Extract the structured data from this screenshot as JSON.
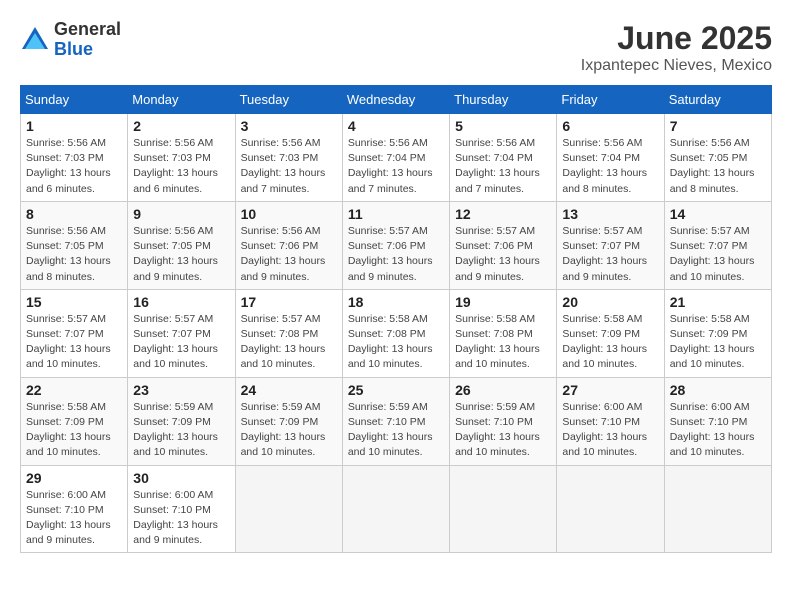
{
  "logo": {
    "general": "General",
    "blue": "Blue"
  },
  "title": {
    "month": "June 2025",
    "location": "Ixpantepec Nieves, Mexico"
  },
  "headers": [
    "Sunday",
    "Monday",
    "Tuesday",
    "Wednesday",
    "Thursday",
    "Friday",
    "Saturday"
  ],
  "weeks": [
    [
      {
        "day": "1",
        "rise": "5:56 AM",
        "set": "7:03 PM",
        "daylight": "13 hours and 6 minutes."
      },
      {
        "day": "2",
        "rise": "5:56 AM",
        "set": "7:03 PM",
        "daylight": "13 hours and 6 minutes."
      },
      {
        "day": "3",
        "rise": "5:56 AM",
        "set": "7:03 PM",
        "daylight": "13 hours and 7 minutes."
      },
      {
        "day": "4",
        "rise": "5:56 AM",
        "set": "7:04 PM",
        "daylight": "13 hours and 7 minutes."
      },
      {
        "day": "5",
        "rise": "5:56 AM",
        "set": "7:04 PM",
        "daylight": "13 hours and 7 minutes."
      },
      {
        "day": "6",
        "rise": "5:56 AM",
        "set": "7:04 PM",
        "daylight": "13 hours and 8 minutes."
      },
      {
        "day": "7",
        "rise": "5:56 AM",
        "set": "7:05 PM",
        "daylight": "13 hours and 8 minutes."
      }
    ],
    [
      {
        "day": "8",
        "rise": "5:56 AM",
        "set": "7:05 PM",
        "daylight": "13 hours and 8 minutes."
      },
      {
        "day": "9",
        "rise": "5:56 AM",
        "set": "7:05 PM",
        "daylight": "13 hours and 9 minutes."
      },
      {
        "day": "10",
        "rise": "5:56 AM",
        "set": "7:06 PM",
        "daylight": "13 hours and 9 minutes."
      },
      {
        "day": "11",
        "rise": "5:57 AM",
        "set": "7:06 PM",
        "daylight": "13 hours and 9 minutes."
      },
      {
        "day": "12",
        "rise": "5:57 AM",
        "set": "7:06 PM",
        "daylight": "13 hours and 9 minutes."
      },
      {
        "day": "13",
        "rise": "5:57 AM",
        "set": "7:07 PM",
        "daylight": "13 hours and 9 minutes."
      },
      {
        "day": "14",
        "rise": "5:57 AM",
        "set": "7:07 PM",
        "daylight": "13 hours and 10 minutes."
      }
    ],
    [
      {
        "day": "15",
        "rise": "5:57 AM",
        "set": "7:07 PM",
        "daylight": "13 hours and 10 minutes."
      },
      {
        "day": "16",
        "rise": "5:57 AM",
        "set": "7:07 PM",
        "daylight": "13 hours and 10 minutes."
      },
      {
        "day": "17",
        "rise": "5:57 AM",
        "set": "7:08 PM",
        "daylight": "13 hours and 10 minutes."
      },
      {
        "day": "18",
        "rise": "5:58 AM",
        "set": "7:08 PM",
        "daylight": "13 hours and 10 minutes."
      },
      {
        "day": "19",
        "rise": "5:58 AM",
        "set": "7:08 PM",
        "daylight": "13 hours and 10 minutes."
      },
      {
        "day": "20",
        "rise": "5:58 AM",
        "set": "7:09 PM",
        "daylight": "13 hours and 10 minutes."
      },
      {
        "day": "21",
        "rise": "5:58 AM",
        "set": "7:09 PM",
        "daylight": "13 hours and 10 minutes."
      }
    ],
    [
      {
        "day": "22",
        "rise": "5:58 AM",
        "set": "7:09 PM",
        "daylight": "13 hours and 10 minutes."
      },
      {
        "day": "23",
        "rise": "5:59 AM",
        "set": "7:09 PM",
        "daylight": "13 hours and 10 minutes."
      },
      {
        "day": "24",
        "rise": "5:59 AM",
        "set": "7:09 PM",
        "daylight": "13 hours and 10 minutes."
      },
      {
        "day": "25",
        "rise": "5:59 AM",
        "set": "7:10 PM",
        "daylight": "13 hours and 10 minutes."
      },
      {
        "day": "26",
        "rise": "5:59 AM",
        "set": "7:10 PM",
        "daylight": "13 hours and 10 minutes."
      },
      {
        "day": "27",
        "rise": "6:00 AM",
        "set": "7:10 PM",
        "daylight": "13 hours and 10 minutes."
      },
      {
        "day": "28",
        "rise": "6:00 AM",
        "set": "7:10 PM",
        "daylight": "13 hours and 10 minutes."
      }
    ],
    [
      {
        "day": "29",
        "rise": "6:00 AM",
        "set": "7:10 PM",
        "daylight": "13 hours and 9 minutes."
      },
      {
        "day": "30",
        "rise": "6:00 AM",
        "set": "7:10 PM",
        "daylight": "13 hours and 9 minutes."
      },
      null,
      null,
      null,
      null,
      null
    ]
  ]
}
